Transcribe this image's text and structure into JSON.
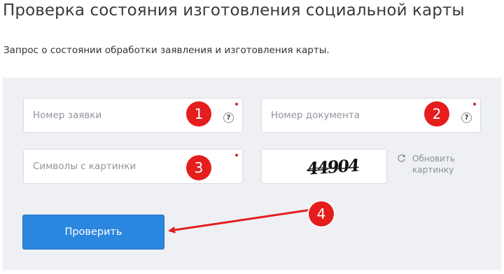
{
  "page": {
    "title": "Проверка состояния изготовления социальной карты",
    "subtitle": "Запрос о состоянии обработки заявления и изготовления карты."
  },
  "form": {
    "application_number": {
      "placeholder": "Номер заявки",
      "value": "",
      "help": "?"
    },
    "document_number": {
      "placeholder": "Номер документа",
      "value": "",
      "help": "?"
    },
    "captcha_input": {
      "placeholder": "Символы с картинки",
      "value": ""
    },
    "captcha_image_text": "44904",
    "refresh_label": "Обновить картинку",
    "submit_label": "Проверить"
  },
  "annotations": [
    "1",
    "2",
    "3",
    "4"
  ],
  "colors": {
    "accent": "#2b86df",
    "badge": "#e51d1d",
    "panel_bg": "#eef0f4",
    "required_dot": "#d22a2a"
  },
  "icons": {
    "help": "question-circle-icon",
    "refresh": "refresh-icon"
  }
}
